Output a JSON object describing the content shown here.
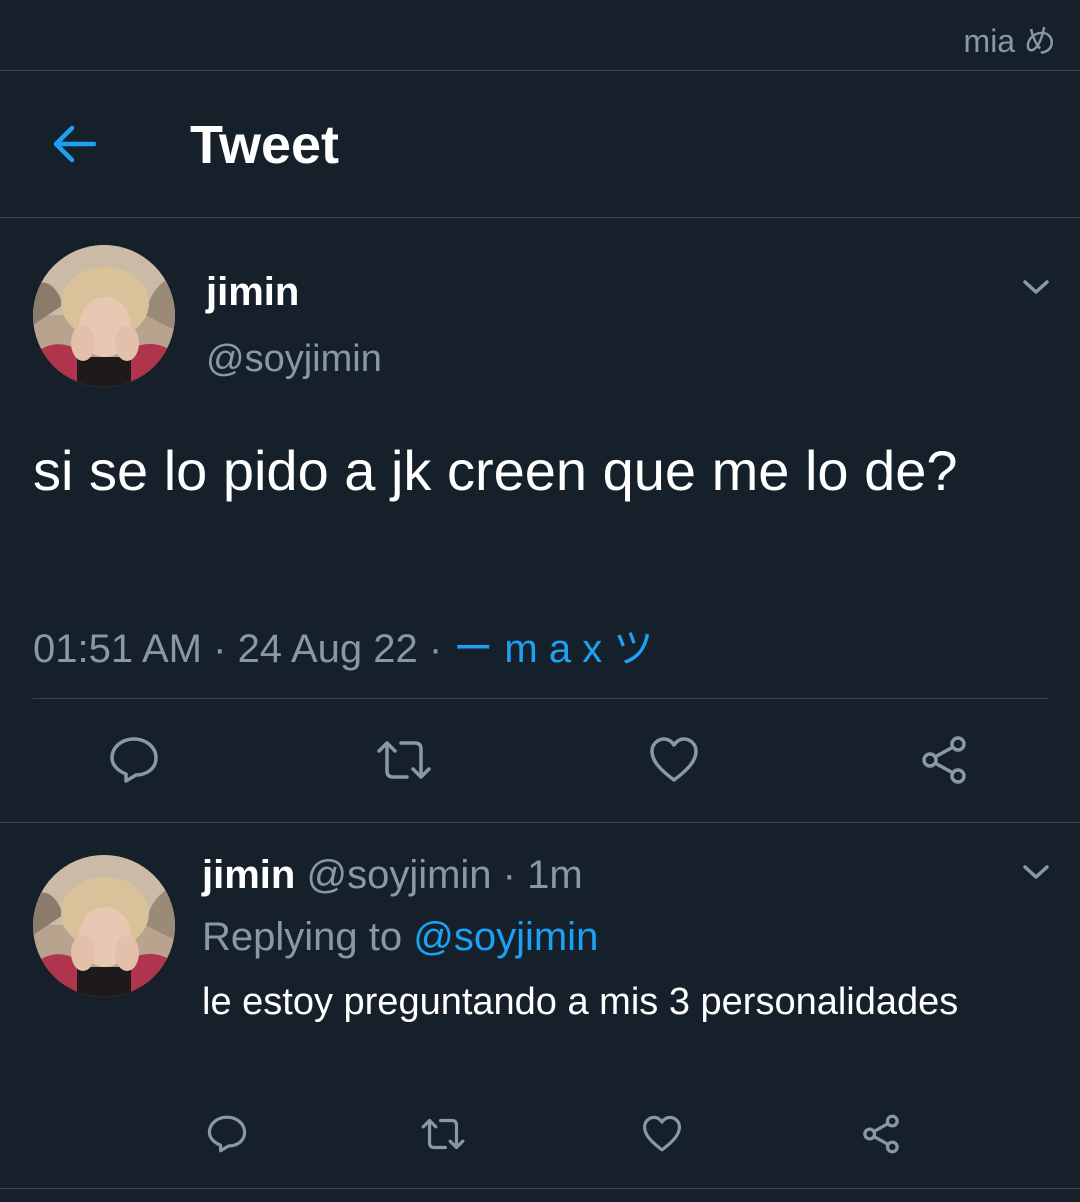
{
  "status_bar": {
    "right_text": "mia め"
  },
  "header": {
    "title": "Tweet",
    "back_icon": "arrow-left-icon"
  },
  "main_tweet": {
    "display_name": "jimin",
    "handle": "@soyjimin",
    "text": "si se lo pido a jk creen que me lo de?",
    "time": "01:51 AM",
    "date": "24 Aug 22",
    "separator": " · ",
    "source": "ー m a x ツ",
    "actions": [
      "reply-icon",
      "retweet-icon",
      "like-icon",
      "share-icon"
    ]
  },
  "reply": {
    "display_name": "jimin",
    "handle": "@soyjimin",
    "age": "1m",
    "dot": " · ",
    "replying_prefix": "Replying to ",
    "replying_to": "@soyjimin",
    "text": "le estoy preguntando a mis 3 personalidades",
    "actions": [
      "reply-icon",
      "retweet-icon",
      "like-icon",
      "share-icon"
    ]
  },
  "colors": {
    "background": "#15202b",
    "accent": "#1da1f2",
    "secondary_text": "#8899a6",
    "divider": "#38444d"
  }
}
